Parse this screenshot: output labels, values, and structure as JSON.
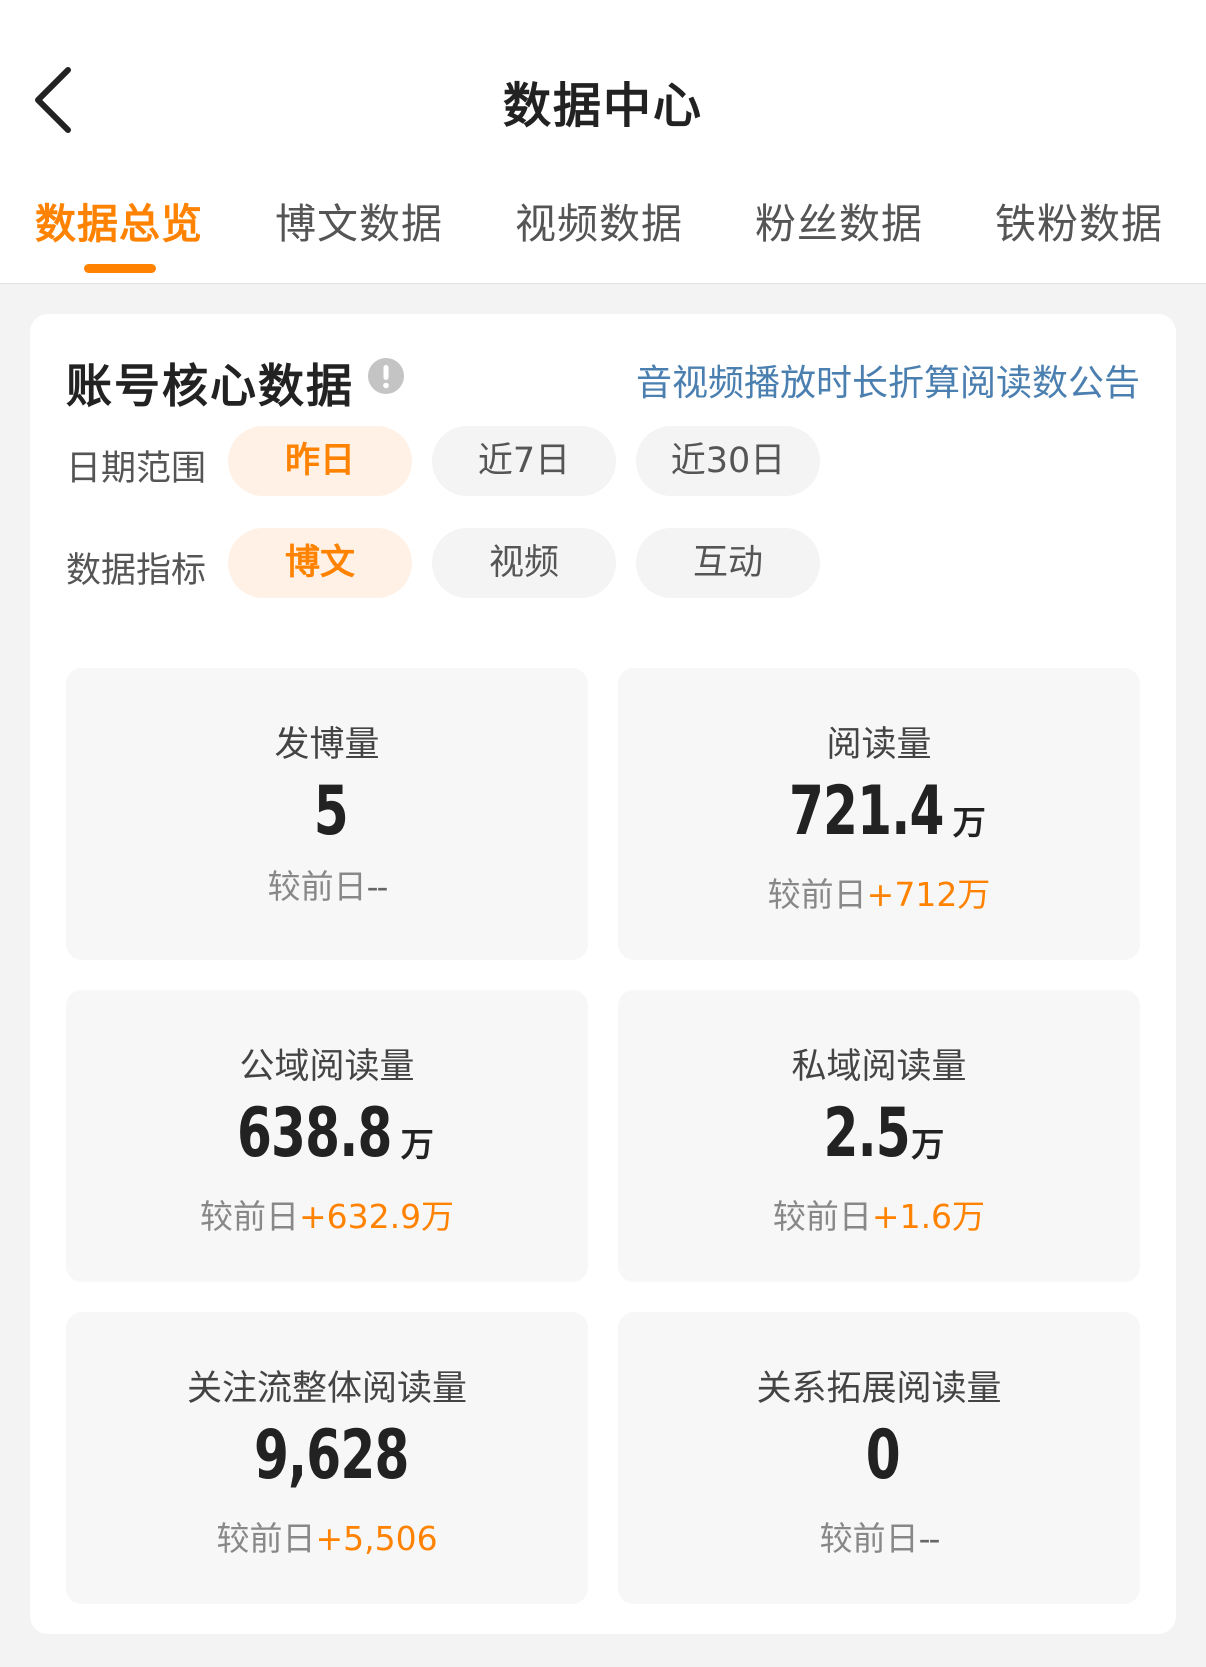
{
  "header": {
    "title": "数据中心",
    "back_icon": "chevron-left-icon"
  },
  "tabs": [
    {
      "label": "数据总览",
      "active": true
    },
    {
      "label": "博文数据",
      "active": false
    },
    {
      "label": "视频数据",
      "active": false
    },
    {
      "label": "粉丝数据",
      "active": false
    },
    {
      "label": "铁粉数据",
      "active": false
    }
  ],
  "colors": {
    "accent": "#ff8200",
    "link": "#4a7fb0"
  },
  "card": {
    "title": "账号核心数据",
    "info_icon": "exclamation-circle-icon",
    "notice_link": "音视频播放时长折算阅读数公告"
  },
  "filters": {
    "date_label": "日期范围",
    "date_options": [
      "昨日",
      "近7日",
      "近30日"
    ],
    "date_selected": "昨日",
    "metric_label": "数据指标",
    "metric_options": [
      "博文",
      "视频",
      "互动"
    ],
    "metric_selected": "博文"
  },
  "stats": [
    {
      "label": "发博量",
      "value": "5",
      "unit": "",
      "compare_prefix": "较前日",
      "delta": "",
      "no_change": "--"
    },
    {
      "label": "阅读量",
      "value": "721.4",
      "unit": "万",
      "compare_prefix": "较前日",
      "delta": "+712万",
      "no_change": ""
    },
    {
      "label": "公域阅读量",
      "value": "638.8",
      "unit": "万",
      "compare_prefix": "较前日",
      "delta": "+632.9万",
      "no_change": ""
    },
    {
      "label": "私域阅读量",
      "value": "2.5",
      "unit": "万",
      "compare_prefix": "较前日",
      "delta": "+1.6万",
      "no_change": ""
    },
    {
      "label": "关注流整体阅读量",
      "value": "9,628",
      "unit": "",
      "compare_prefix": "较前日",
      "delta": "+5,506",
      "no_change": ""
    },
    {
      "label": "关系拓展阅读量",
      "value": "0",
      "unit": "",
      "compare_prefix": "较前日",
      "delta": "",
      "no_change": "--"
    }
  ]
}
